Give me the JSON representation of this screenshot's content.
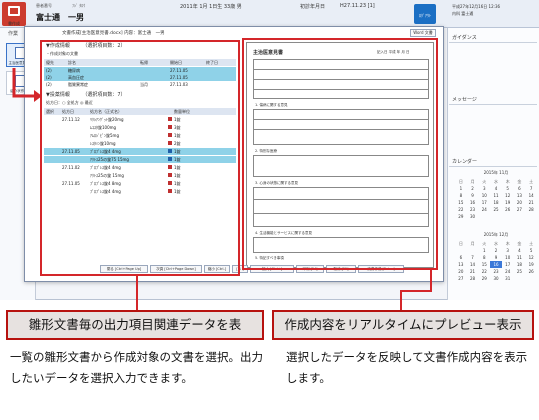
{
  "topbar": {
    "save_label": "書作成",
    "patient_id": "患者番号",
    "patient_kana": "ﾌｼﾞ ﾀﾛｳ",
    "patient_name": "富士通　一男",
    "visit": "2011年 1月 1日生 33歳 男",
    "dept": "初診年月日",
    "status": "H27.11.23 [1]",
    "right_info_1": "平成27年12月16日  12:36",
    "right_info_2": "内科   富士通",
    "blue_btn": "ﾛｸﾞｱｳﾄ"
  },
  "leftcol": {
    "tab": "作業",
    "doc1": "主治医意見書",
    "doc2": "紹介状作成"
  },
  "dialog": {
    "title": "文書作成[主治医意見書.docx]  内容：富士通　一男",
    "close": "Word 文書",
    "section1": "▼作成情報　　　（選択項目数：2）",
    "section2": "・作成対象の文書",
    "table1_headers": [
      "優先",
      "診名",
      "転帰",
      "開始日",
      "終了日"
    ],
    "table1_rows": [
      {
        "c1": "(2)",
        "c2": "糖尿病",
        "c3": "",
        "c4": "27.11.05",
        "c5": "",
        "sel": true
      },
      {
        "c1": "(2)",
        "c2": "高血圧症",
        "c3": "",
        "c4": "27.11.05",
        "c5": "",
        "sel": true
      },
      {
        "c1": "(2)",
        "c2": "脂質異常症",
        "c3": "当月",
        "c4": "27.11.03",
        "c5": "",
        "sel": false
      }
    ],
    "section3": "▼投薬情報　　　（選択項目数：7）",
    "radio": "処方日：○ 全処方  ◎ 最近",
    "table2_headers": [
      "選択",
      "処方日",
      "処方名（正式名）",
      "数量単位"
    ],
    "table2_rows": [
      {
        "c1": "27.11.12",
        "c2": "ﾘｸｼｱﾝｹﾞｯﾄ錠20mg",
        "c3": "1錠",
        "sel": false
      },
      {
        "c1": "",
        "c2": "ﾑｺｽﾀ錠100mg",
        "c3": "3錠",
        "sel": false
      },
      {
        "c1": "",
        "c2": "ｱﾑﾛｼﾞﾋﾟﾝ錠5mg",
        "c3": "1錠",
        "sel": false
      },
      {
        "c1": "",
        "c2": "ﾚｽﾀﾐﾝ錠10mg",
        "c3": "2錠",
        "sel": false
      },
      {
        "c1": "27.11.05",
        "c2": "ﾌﾟﾛﾌﾟﾚｽ錠4  4mg",
        "c3": "1錠",
        "sel": true
      },
      {
        "c1": "",
        "c2": "ｱｸﾄｽ25の錠75  15mg",
        "c3": "1錠",
        "sel": true
      },
      {
        "c1": "27.11.02",
        "c2": "ﾌﾟﾛﾌﾟﾚｽ錠4  4mg",
        "c3": "1錠",
        "sel": false
      },
      {
        "c1": "",
        "c2": "ｱｸﾄｽ25の錠  15mg",
        "c3": "1錠",
        "sel": false
      },
      {
        "c1": "27.11.05",
        "c2": "ﾌﾟﾛﾌﾟﾚｽ錠4  8mg",
        "c3": "1錠",
        "sel": false
      },
      {
        "c1": "",
        "c2": "ﾌﾟﾛﾌﾟﾚｽ錠4  4mg",
        "c3": "1錠",
        "sel": false
      }
    ],
    "fkeys": [
      "閉る [Ctrl+Page Up]",
      "次頁 [Ctrl+Page Down]",
      "縮小 [Ctrl-]",
      "[ 1 ]",
      "拡大 [Ctrl+]",
      "印刷 [F4]",
      "取消 [F5]",
      "文書作成 [Enter]"
    ]
  },
  "preview": {
    "title": "主治医意見書",
    "date": "記入日 平成 年 月 日",
    "labels": [
      "1. 傷病に関する意見",
      "2. 特別な医療",
      "3. 心身の状態に関する意見",
      "4. 生活機能とサービスに関する意見",
      "5. 特記すべき事項"
    ]
  },
  "rightpane": {
    "guidance": "ガイダンス",
    "message": "メッセージ",
    "calendar": "カレンダー",
    "cal1_title": "2015年 11月",
    "cal2_title": "2015年 12月",
    "weekdays": [
      "日",
      "月",
      "火",
      "水",
      "木",
      "金",
      "土"
    ],
    "cal1_days": [
      "1",
      "2",
      "3",
      "4",
      "5",
      "6",
      "7",
      "8",
      "9",
      "10",
      "11",
      "12",
      "13",
      "14",
      "15",
      "16",
      "17",
      "18",
      "19",
      "20",
      "21",
      "22",
      "23",
      "24",
      "25",
      "26",
      "27",
      "28",
      "29",
      "30"
    ],
    "cal2_days": [
      "",
      "",
      "1",
      "2",
      "3",
      "4",
      "5",
      "6",
      "7",
      "8",
      "9",
      "10",
      "11",
      "12",
      "13",
      "14",
      "15",
      "16",
      "17",
      "18",
      "19",
      "20",
      "21",
      "22",
      "23",
      "24",
      "25",
      "26",
      "27",
      "28",
      "29",
      "30",
      "31"
    ]
  },
  "callouts": {
    "left_title": "雛形文書毎の出力項目関連データを表",
    "left_body": "一覧の雛形文書から作成対象の文書を選択。出力したいデータを選択入力できます。",
    "right_title": "作成内容をリアルタイムにプレビュー表示",
    "right_body": "選択したデータを反映して文書作成内容を表示します。"
  },
  "colors": {
    "accent_red": "#d4262a",
    "selection_blue": "#8fd2e8",
    "brand_red": "#cc3b2e",
    "callout_bg": "#e7e2e0"
  }
}
